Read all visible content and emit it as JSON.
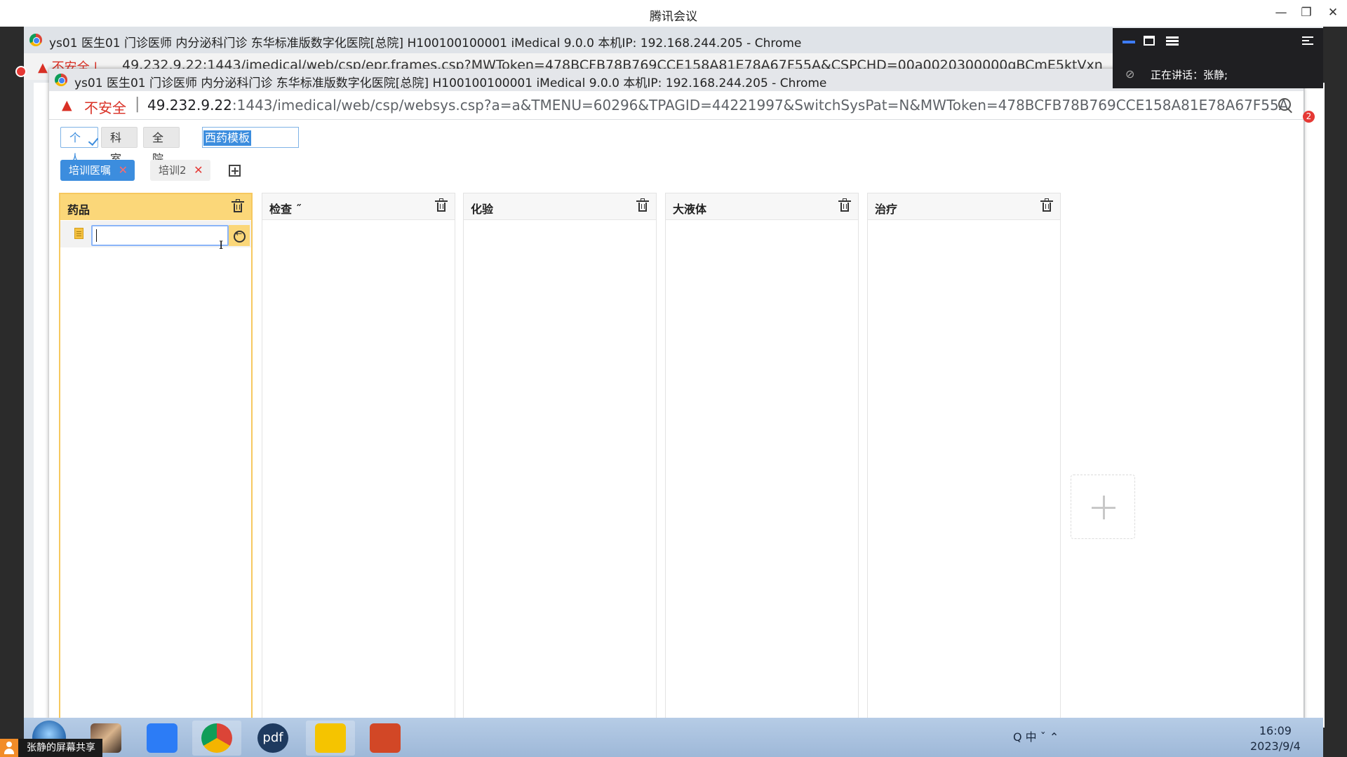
{
  "meeting": {
    "title": "腾讯会议",
    "speaking_text": "正在讲话：张静;",
    "share_label": "张静的屏幕共享"
  },
  "back_window": {
    "title": "ys01 医生01 门诊医师 内分泌科门诊 东华标准版数字化医院[总院] H100100100001 iMedical 9.0.0 本机IP: 192.168.244.205 - Chrome",
    "insecure": "不安全",
    "url": "49.232.9.22:1443/imedical/web/csp/epr.frames.csp?MWToken=478BCFB78B769CCE158A81E78A67F55A&CSPCHD=00a0020300000gBCmE5ktVxn"
  },
  "front_window": {
    "title": "ys01 医生01 门诊医师 内分泌科门诊 东华标准版数字化医院[总院] H100100100001 iMedical 9.0.0 本机IP: 192.168.244.205 - Chrome",
    "insecure": "不安全",
    "url_host": "49.232.9.22",
    "url_rest": ":1443/imedical/web/csp/websys.csp?a=a&TMENU=60296&TPAGID=44221997&SwitchSysPat=N&MWToken=478BCFB78B769CCE158A81E78A67F55A"
  },
  "scope_tabs": [
    {
      "label": "个人",
      "active": true
    },
    {
      "label": "科室",
      "active": false
    },
    {
      "label": "全院",
      "active": false
    }
  ],
  "template_input": {
    "value": "西药模板"
  },
  "template_chips": [
    {
      "label": "培训医嘱",
      "active": true,
      "close": "✕"
    },
    {
      "label": "培训2",
      "active": false,
      "close": "✕"
    }
  ],
  "columns": [
    {
      "title": "药品",
      "active": true
    },
    {
      "title": "检查 ˝",
      "active": false
    },
    {
      "title": "化验",
      "active": false
    },
    {
      "title": "大液体",
      "active": false
    },
    {
      "title": "治疗",
      "active": false
    }
  ],
  "notification_badge": "2",
  "taskbar": {
    "apps": [
      "photos",
      "tencent-meeting",
      "chrome",
      "pdf-pro",
      "wechat",
      "powerpoint"
    ],
    "pdf_label": "pdf",
    "tray_text": "Q 中 ˇ ⌃",
    "time": "16:09",
    "date": "2023/9/4"
  },
  "colors": {
    "accent_blue": "#3c8dde",
    "drug_column_yellow": "#fbd779",
    "warning_red": "#d93025"
  }
}
